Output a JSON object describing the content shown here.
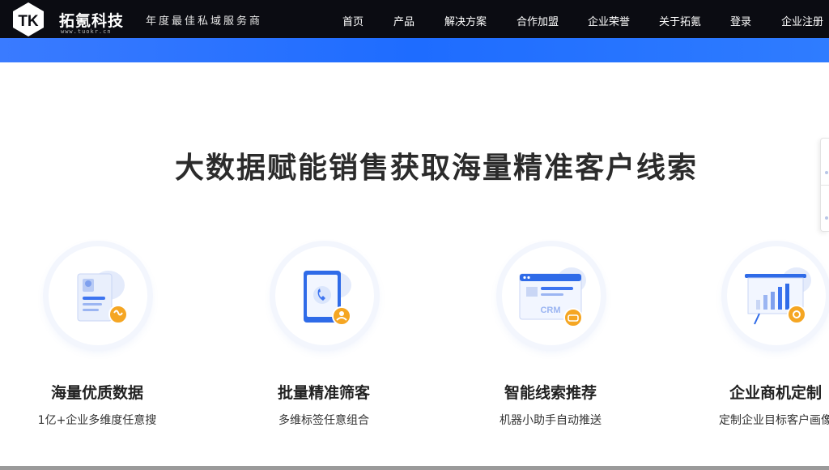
{
  "header": {
    "logo_text": "拓氪科技",
    "logo_mark": "TK",
    "logo_url": "www.tuokr.cn",
    "slogan": "年度最佳私域服务商",
    "nav": [
      {
        "label": "首页"
      },
      {
        "label": "产品"
      },
      {
        "label": "解决方案"
      },
      {
        "label": "合作加盟"
      },
      {
        "label": "企业荣誉"
      },
      {
        "label": "关于拓氪"
      },
      {
        "label": "登录"
      },
      {
        "label": "企业注册"
      }
    ]
  },
  "main": {
    "heading": "大数据赋能销售获取海量精准客户线索",
    "features": [
      {
        "title": "海量优质数据",
        "desc": "1亿+企业多维度任意搜",
        "icon": "data-card-icon"
      },
      {
        "title": "批量精准筛客",
        "desc": "多维标签任意组合",
        "icon": "tablet-call-icon"
      },
      {
        "title": "智能线索推荐",
        "desc": "机器小助手自动推送",
        "icon": "crm-window-icon"
      },
      {
        "title": "企业商机定制",
        "desc": "定制企业目标客户画像",
        "icon": "chart-board-icon"
      }
    ]
  },
  "colors": {
    "header_bg": "#0b0c12",
    "accent_blue": "#1e6cff",
    "badge_orange": "#f5a623"
  }
}
